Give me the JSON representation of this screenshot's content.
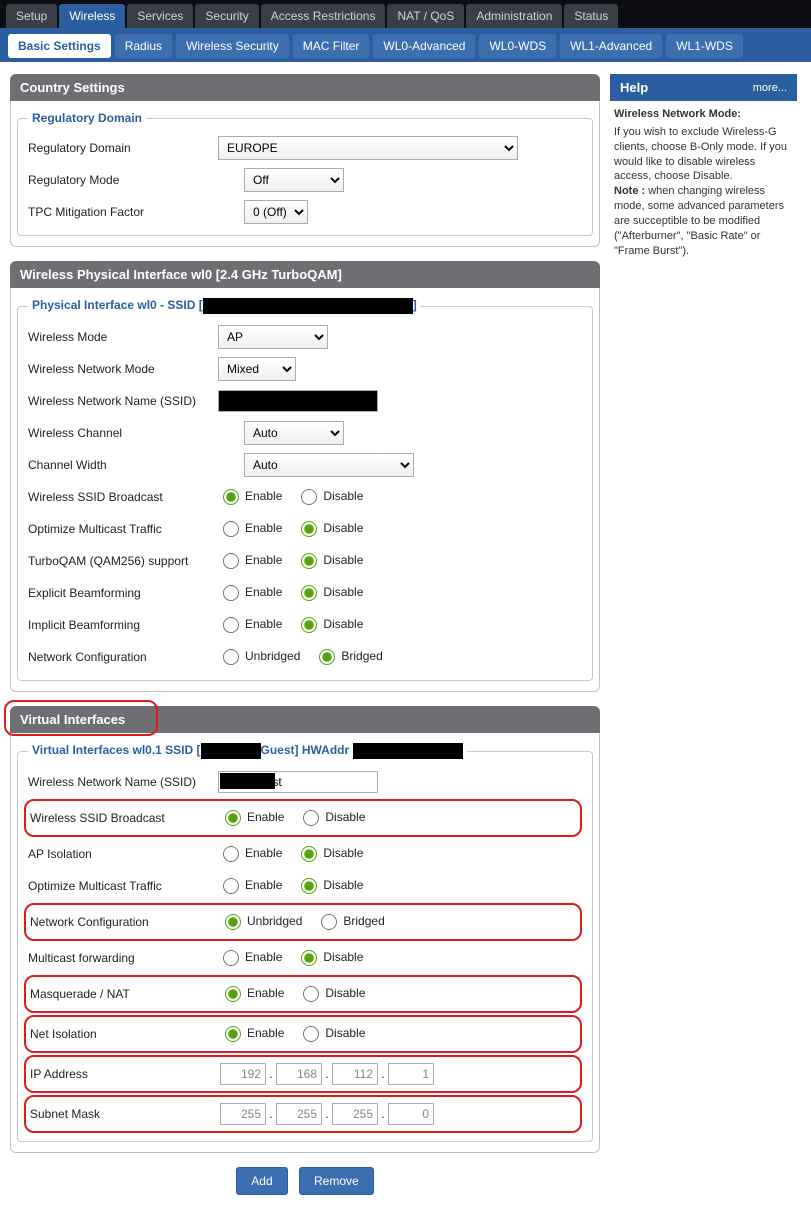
{
  "topnav": {
    "items": [
      "Setup",
      "Wireless",
      "Services",
      "Security",
      "Access Restrictions",
      "NAT / QoS",
      "Administration",
      "Status"
    ],
    "active": 1
  },
  "subnav": {
    "items": [
      "Basic Settings",
      "Radius",
      "Wireless Security",
      "MAC Filter",
      "WL0-Advanced",
      "WL0-WDS",
      "WL1-Advanced",
      "WL1-WDS"
    ],
    "active": 0
  },
  "help": {
    "title": "Help",
    "more": "more...",
    "heading": "Wireless Network Mode:",
    "body": "If you wish to exclude Wireless-G clients, choose B-Only mode. If you would like to disable wireless access, choose Disable.",
    "note_label": "Note :",
    "note": " when changing wireless mode, some advanced parameters are succeptible to be modified (\"Afterburner\", \"Basic Rate\" or \"Frame Burst\")."
  },
  "country": {
    "title": "Country Settings",
    "legend": "Regulatory Domain",
    "rows": {
      "domain": {
        "label": "Regulatory Domain",
        "value": "EUROPE"
      },
      "mode": {
        "label": "Regulatory Mode",
        "value": "Off"
      },
      "tpc": {
        "label": "TPC Mitigation Factor",
        "value": "0 (Off)"
      }
    }
  },
  "phy": {
    "title": "Wireless Physical Interface wl0 [2.4 GHz TurboQAM]",
    "legend_prefix": "Physical Interface wl0 - SSID [",
    "legend_suffix": "]",
    "rows": {
      "mode": {
        "label": "Wireless Mode",
        "value": "AP"
      },
      "netmode": {
        "label": "Wireless Network Mode",
        "value": "Mixed"
      },
      "ssid": {
        "label": "Wireless Network Name (SSID)",
        "value": "███████████"
      },
      "channel": {
        "label": "Wireless Channel",
        "value": "Auto"
      },
      "width": {
        "label": "Channel Width",
        "value": "Auto"
      },
      "bcast": {
        "label": "Wireless SSID Broadcast",
        "sel": "enable"
      },
      "multi": {
        "label": "Optimize Multicast Traffic",
        "sel": "disable"
      },
      "turbo": {
        "label": "TurboQAM (QAM256) support",
        "sel": "disable"
      },
      "ebf": {
        "label": "Explicit Beamforming",
        "sel": "disable"
      },
      "ibf": {
        "label": "Implicit Beamforming",
        "sel": "disable"
      },
      "netcfg": {
        "label": "Network Configuration",
        "sel": "bridged",
        "opts": [
          "Unbridged",
          "Bridged"
        ]
      }
    },
    "ed": {
      "enable": "Enable",
      "disable": "Disable"
    }
  },
  "virt": {
    "title": "Virtual Interfaces",
    "legend_prefix": "Virtual Interfaces wl0.1 SSID [",
    "legend_mid": "Guest] HWAddr ",
    "rows": {
      "ssid": {
        "label": "Wireless Network Name (SSID)",
        "value_prefix": "████",
        "value": "Guest"
      },
      "bcast": {
        "label": "Wireless SSID Broadcast",
        "sel": "enable"
      },
      "apiso": {
        "label": "AP Isolation",
        "sel": "disable"
      },
      "multi": {
        "label": "Optimize Multicast Traffic",
        "sel": "disable"
      },
      "netcfg": {
        "label": "Network Configuration",
        "sel": "unbridged",
        "opts": [
          "Unbridged",
          "Bridged"
        ]
      },
      "mfwd": {
        "label": "Multicast forwarding",
        "sel": "disable"
      },
      "masq": {
        "label": "Masquerade / NAT",
        "sel": "enable"
      },
      "netiso": {
        "label": "Net Isolation",
        "sel": "enable"
      },
      "ip": {
        "label": "IP Address",
        "oct": [
          "192",
          "168",
          "112",
          "1"
        ]
      },
      "mask": {
        "label": "Subnet Mask",
        "oct": [
          "255",
          "255",
          "255",
          "0"
        ]
      }
    }
  },
  "buttons": {
    "add": "Add",
    "remove": "Remove"
  }
}
